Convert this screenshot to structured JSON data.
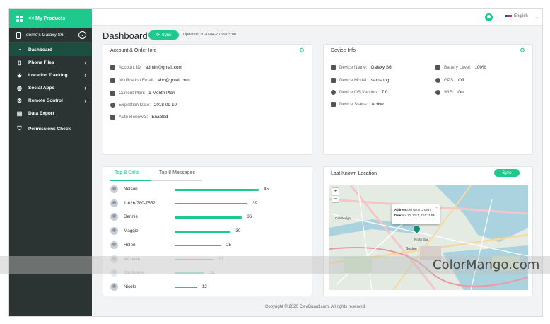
{
  "sidebar": {
    "brand": "<< My Products",
    "device": "demo's Galaxy S6",
    "items": [
      {
        "label": "Dashboard",
        "icon": "dashboard-icon"
      },
      {
        "label": "Phone Files",
        "icon": "phone-files-icon"
      },
      {
        "label": "Location Tracking",
        "icon": "location-icon"
      },
      {
        "label": "Social Apps",
        "icon": "chat-icon"
      },
      {
        "label": "Remote Control",
        "icon": "remote-control-icon"
      },
      {
        "label": "Data Export",
        "icon": "export-icon"
      },
      {
        "label": "Permissions Check",
        "icon": "shield-icon"
      }
    ]
  },
  "topbar": {
    "language": "English"
  },
  "header": {
    "title": "Dashboard",
    "sync_label": "Sync",
    "updated": "Updated: 2020-04-20 19:05:00"
  },
  "account": {
    "title": "Account & Order Info",
    "rows": [
      {
        "label": "Account ID:",
        "value": "admin@gmail.com"
      },
      {
        "label": "Notification Email:",
        "value": "abc@gmail.com"
      },
      {
        "label": "Current Plan:",
        "value": "1-Month Plan"
      },
      {
        "label": "Expiration Date:",
        "value": "2018-09-10"
      },
      {
        "label": "Auto-Renewal:",
        "value": "Enabled"
      }
    ]
  },
  "device": {
    "title": "Device Info",
    "left": [
      {
        "label": "Device Name:",
        "value": "Galaxy S6"
      },
      {
        "label": "Device Model:",
        "value": "samsung"
      },
      {
        "label": "Device OS Version:",
        "value": "7.0"
      },
      {
        "label": "Device Status:",
        "value": "Active"
      }
    ],
    "right": [
      {
        "label": "Battery Level:",
        "value": "100%"
      },
      {
        "label": "GPS:",
        "value": "Off"
      },
      {
        "label": "WiFi:",
        "value": "On"
      }
    ]
  },
  "calls": {
    "tabs": [
      "Top 8 Calls",
      "Top 8 Messages"
    ],
    "items": [
      {
        "name": "Nelson",
        "count": "45",
        "value": 45
      },
      {
        "name": "1-626-780-7552",
        "count": "39",
        "value": 39
      },
      {
        "name": "Dennie",
        "count": "36",
        "value": 36
      },
      {
        "name": "Maggie",
        "count": "30",
        "value": 30
      },
      {
        "name": "Helen",
        "count": "25",
        "value": 25
      },
      {
        "name": "Michelle",
        "count": "21",
        "value": 21
      },
      {
        "name": "Stephenie",
        "count": "16",
        "value": 16
      },
      {
        "name": "Nicole",
        "count": "12",
        "value": 12
      }
    ]
  },
  "location": {
    "title": "Last Known Location",
    "sync_label": "Sync",
    "popup_address_label": "Address:",
    "popup_address": "Old North Church",
    "popup_date_label": "Date:",
    "popup_date": "Apr 10, 2017, 3:51:31 PM",
    "map_labels": [
      "Cambridge",
      "North End",
      "Boston"
    ]
  },
  "footer": "Copyright © 2020 ClevGuard.com. All rights reserved.",
  "watermark": "ColorMango.com",
  "colors": {
    "accent": "#1fc98e",
    "sidebar": "#2b3432"
  }
}
